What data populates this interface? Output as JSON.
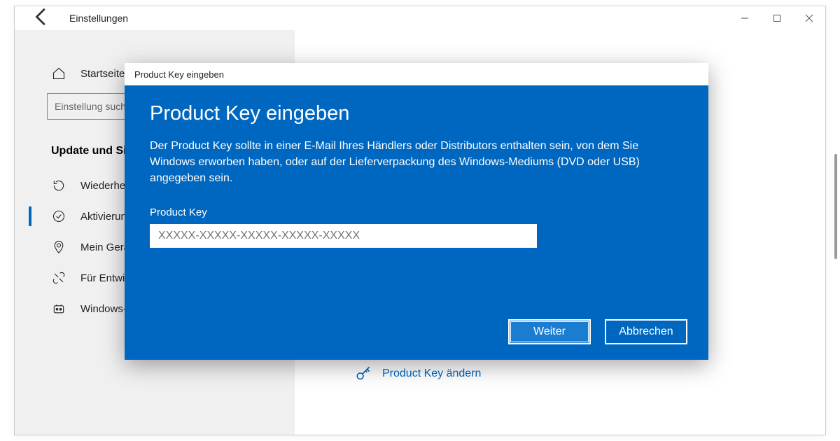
{
  "window": {
    "title": "Einstellungen"
  },
  "sidebar": {
    "home_label": "Startseite",
    "search_placeholder": "Einstellung suchen",
    "category": "Update und Sicherheit",
    "items": [
      {
        "label": "Wiederherstellung",
        "icon": "refresh"
      },
      {
        "label": "Aktivierung",
        "icon": "check-circle"
      },
      {
        "label": "Mein Gerät suchen",
        "icon": "location"
      },
      {
        "label": "Für Entwickler",
        "icon": "tools"
      },
      {
        "label": "Windows-Insider-Programm",
        "icon": "insider"
      }
    ]
  },
  "content": {
    "change_key_link": "Product Key ändern"
  },
  "dialog": {
    "window_title": "Product Key eingeben",
    "heading": "Product Key eingeben",
    "description": "Der Product Key sollte in einer E-Mail Ihres Händlers oder Distributors enthalten sein, von dem Sie Windows erworben haben, oder auf der Lieferverpackung des Windows-Mediums (DVD oder USB) angegeben sein.",
    "field_label": "Product Key",
    "field_placeholder": "XXXXX-XXXXX-XXXXX-XXXXX-XXXXX",
    "next_label": "Weiter",
    "cancel_label": "Abbrechen"
  }
}
